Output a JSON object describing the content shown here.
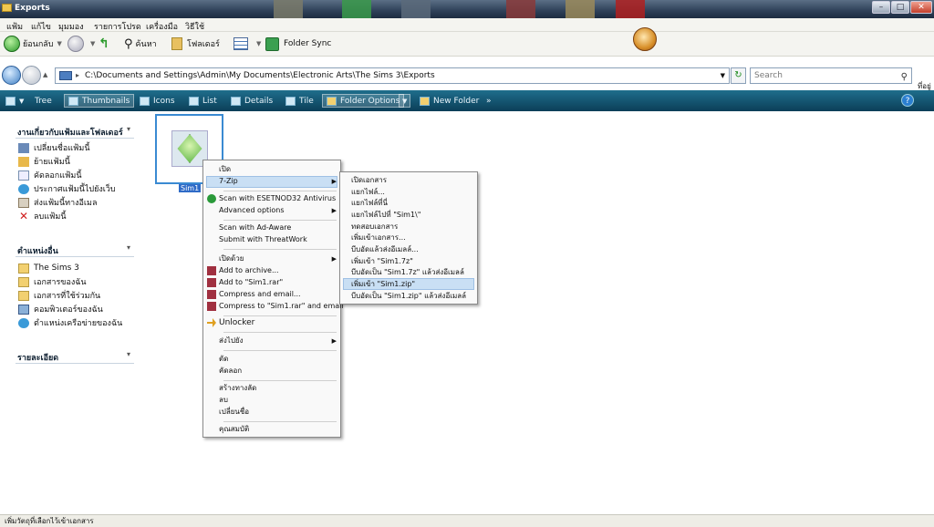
{
  "window": {
    "title": "Exports"
  },
  "menubar": {
    "items": [
      "แฟ้ม",
      "แก้ไข",
      "มุมมอง",
      "รายการโปรด",
      "เครื่องมือ",
      "วิธีใช้"
    ]
  },
  "toolbar": {
    "back_label": "ย้อนกลับ",
    "search_label": "ค้นหา",
    "folders_label": "โฟลเดอร์",
    "folder_sync_label": "Folder Sync"
  },
  "address": {
    "path": "C:\\Documents and Settings\\Admin\\My Documents\\Electronic Arts\\The Sims 3\\Exports",
    "search_placeholder": "Search",
    "side_text": "ที่อยู่"
  },
  "viewbar": {
    "items": [
      "Tree",
      "Thumbnails",
      "Icons",
      "List",
      "Details",
      "Tile",
      "Folder Options",
      "New Folder"
    ],
    "more": "»"
  },
  "sidebar": {
    "file_tasks": {
      "title": "งานเกี่ยวกับแฟ้มและโฟลเดอร์",
      "items": [
        "เปลี่ยนชื่อแฟ้มนี้",
        "ย้ายแฟ้มนี้",
        "คัดลอกแฟ้มนี้",
        "ประกาศแฟ้มนี้ไปยังเว็บ",
        "ส่งแฟ้มนี้ทางอีเมล",
        "ลบแฟ้มนี้"
      ]
    },
    "other_places": {
      "title": "ตำแหน่งอื่น",
      "items": [
        "The Sims 3",
        "เอกสารของฉัน",
        "เอกสารที่ใช้ร่วมกัน",
        "คอมพิวเตอร์ของฉัน",
        "ตำแหน่งเครือข่ายของฉัน"
      ]
    },
    "details": {
      "title": "รายละเอียด"
    }
  },
  "file": {
    "name": "Sim1"
  },
  "context_menu": {
    "items": [
      "เปิด",
      "7-Zip",
      "Scan with ESETNOD32 Antivirus",
      "Advanced options",
      "Scan with Ad-Aware",
      "Submit with ThreatWork",
      "เปิดด้วย",
      "Add to archive...",
      "Add to \"Sim1.rar\"",
      "Compress and email...",
      "Compress to \"Sim1.rar\" and email",
      "Unlocker",
      "ส่งไปยัง",
      "ตัด",
      "คัดลอก",
      "สร้างทางลัด",
      "ลบ",
      "เปลี่ยนชื่อ",
      "คุณสมบัติ"
    ]
  },
  "submenu": {
    "items": [
      "เปิดเอกสาร",
      "แยกไฟล์...",
      "แยกไฟล์ที่นี่",
      "แยกไฟล์ไปที่ \"Sim1\\\"",
      "ทดสอบเอกสาร",
      "เพิ่มเข้าเอกสาร...",
      "บีบอัดแล้วส่งอีเมลล์...",
      "เพิ่มเข้า \"Sim1.7z\"",
      "บีบอัดเป็น \"Sim1.7z\" แล้วส่งอีเมลล์",
      "เพิ่มเข้า \"Sim1.zip\"",
      "บีบอัดเป็น \"Sim1.zip\" แล้วส่งอีเมลล์"
    ]
  },
  "statusbar": {
    "text": "เพิ่มวัตถุที่เลือกไว้เข้าเอกสาร"
  },
  "colors": {
    "accent": "#2f6bc7",
    "viewbar": "#0b3e58"
  }
}
